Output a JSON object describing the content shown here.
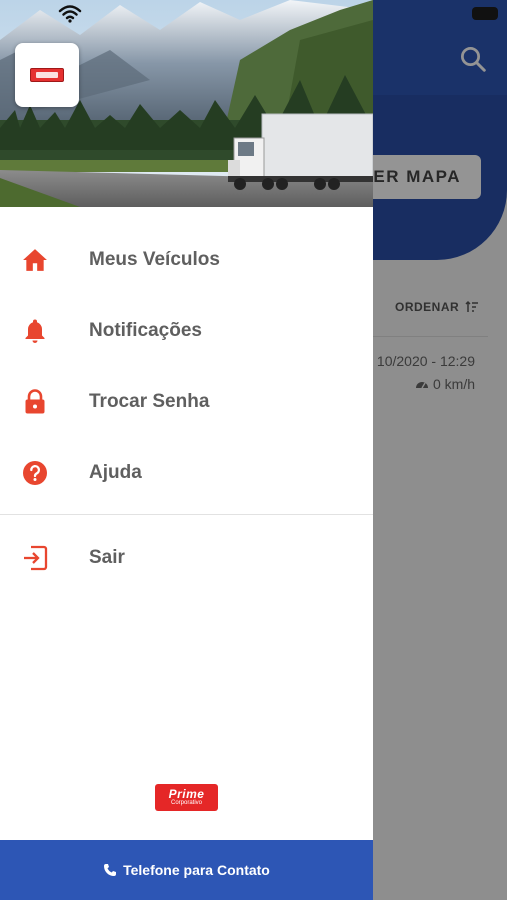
{
  "background_screen": {
    "map_button_label": "VER MAPA",
    "order_label": "ORDENAR",
    "entry_datetime": "10/2020 - 12:29",
    "entry_speed": "0 km/h"
  },
  "drawer": {
    "menu": [
      {
        "label": "Meus Veículos",
        "icon": "home-icon"
      },
      {
        "label": "Notificações",
        "icon": "bell-icon"
      },
      {
        "label": "Trocar Senha",
        "icon": "lock-icon"
      },
      {
        "label": "Ajuda",
        "icon": "help-circle-icon"
      }
    ],
    "logout": {
      "label": "Sair",
      "icon": "logout-icon"
    },
    "brand": {
      "name": "Prime",
      "tagline": "Corporativo"
    },
    "footer": {
      "label": "Telefone para Contato",
      "icon": "phone-icon"
    }
  },
  "colors": {
    "accent": "#e8462f",
    "primary_blue": "#2d56b5",
    "menu_text": "#5f5f5f"
  }
}
